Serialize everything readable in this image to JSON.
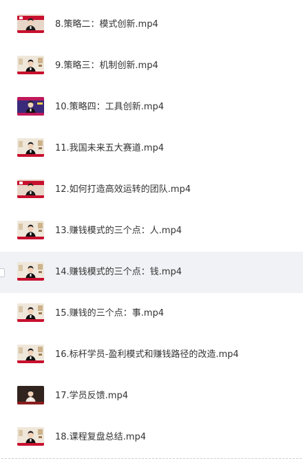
{
  "files": [
    {
      "name": "8.策略二：模式创新.mp4",
      "thumb": "brand"
    },
    {
      "name": "9.策略三：机制创新.mp4",
      "thumb": "studio"
    },
    {
      "name": "10.策略四：工具创新.mp4",
      "thumb": "purple"
    },
    {
      "name": "11.我国未来五大赛道.mp4",
      "thumb": "studio"
    },
    {
      "name": "12.如何打造高效运转的团队.mp4",
      "thumb": "brand"
    },
    {
      "name": "13.赚钱模式的三个点：人.mp4",
      "thumb": "studio"
    },
    {
      "name": "14.赚钱模式的三个点：钱.mp4",
      "thumb": "studio"
    },
    {
      "name": "15.赚钱的三个点：事.mp4",
      "thumb": "studio"
    },
    {
      "name": "16.标杆学员-盈利模式和赚钱路径的改造.mp4",
      "thumb": "studio"
    },
    {
      "name": "17.学员反馈.mp4",
      "thumb": "dark"
    },
    {
      "name": "18.课程复盘总结.mp4",
      "thumb": "studio"
    }
  ],
  "hovered_index": 6
}
